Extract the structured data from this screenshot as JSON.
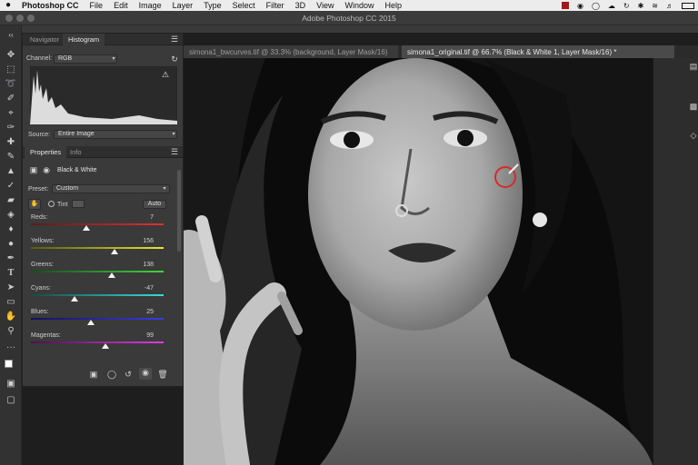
{
  "menubar": {
    "apple": "",
    "app": "Photoshop CC",
    "items": [
      "File",
      "Edit",
      "Image",
      "Layer",
      "Type",
      "Select",
      "Filter",
      "3D",
      "View",
      "Window",
      "Help"
    ]
  },
  "window": {
    "title": "Adobe Photoshop CC 2015"
  },
  "doc_tabs": [
    {
      "label": "simona1_bwcurves.tif @ 33.3% (background, Layer Mask/16)",
      "active": false
    },
    {
      "label": "simona1_original.tif @ 66.7% (Black & White 1, Layer Mask/16) *",
      "active": true
    }
  ],
  "histogram_panel": {
    "tabs": [
      "Navigator",
      "Histogram"
    ],
    "active_tab": "Histogram",
    "channel_label": "Channel:",
    "channel_value": "RGB",
    "source_label": "Source:",
    "source_value": "Entire Image"
  },
  "properties_panel": {
    "tabs": [
      "Properties",
      "Info"
    ],
    "active_tab": "Properties",
    "adjustment_title": "Black & White",
    "preset_label": "Preset:",
    "preset_value": "Custom",
    "tint_label": "Tint",
    "auto_label": "Auto",
    "sliders": [
      {
        "label": "Reds:",
        "value": "7",
        "pos": 0.42,
        "colors": [
          "#5a1a1a",
          "#e23030"
        ]
      },
      {
        "label": "Yellows:",
        "value": "156",
        "pos": 0.63,
        "colors": [
          "#5a5a10",
          "#e6e636"
        ]
      },
      {
        "label": "Greens:",
        "value": "138",
        "pos": 0.61,
        "colors": [
          "#1a4a1a",
          "#3ed63e"
        ]
      },
      {
        "label": "Cyans:",
        "value": "-47",
        "pos": 0.33,
        "colors": [
          "#164a4a",
          "#3cd8d8"
        ]
      },
      {
        "label": "Blues:",
        "value": "25",
        "pos": 0.45,
        "colors": [
          "#121258",
          "#3a3ae6"
        ]
      },
      {
        "label": "Magentas:",
        "value": "99",
        "pos": 0.56,
        "colors": [
          "#4a124a",
          "#e23ae2"
        ]
      }
    ]
  },
  "colors": {
    "panel_bg": "#3a3a3a",
    "app_bg": "#1e1e1e",
    "menubar_bg": "#ececec",
    "cursor_ring": "#d42b2b"
  }
}
